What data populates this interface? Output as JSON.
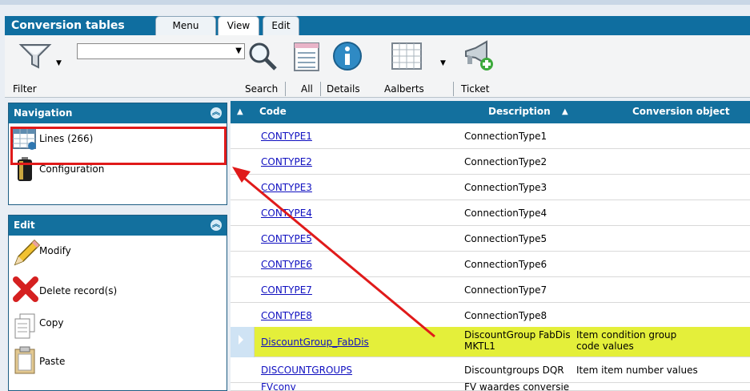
{
  "app": {
    "title": "Conversion tables",
    "tabs": [
      {
        "label": "Menu"
      },
      {
        "label": "View"
      },
      {
        "label": "Edit"
      }
    ]
  },
  "ribbon": {
    "filter_label": "Filter",
    "filter_value": "",
    "search_label": "Search",
    "all_label": "All",
    "details_label": "Details",
    "aalberts_label": "Aalberts",
    "ticket_label": "Ticket"
  },
  "navigation": {
    "title": "Navigation",
    "items": [
      {
        "label": "Lines (266)",
        "icon": "table-icon"
      },
      {
        "label": "Configuration",
        "icon": "battery-icon"
      }
    ]
  },
  "edit": {
    "title": "Edit",
    "items": [
      {
        "label": "Modify",
        "icon": "pencil-icon"
      },
      {
        "label": "Delete record(s)",
        "icon": "delete-x-icon"
      },
      {
        "label": "Copy",
        "icon": "copy-icon"
      },
      {
        "label": "Paste",
        "icon": "paste-icon"
      }
    ]
  },
  "grid": {
    "columns": [
      {
        "label": "Code"
      },
      {
        "label": "Description"
      },
      {
        "label": "Conversion object"
      }
    ],
    "rows": [
      {
        "code": "CONTYPE1",
        "desc": "ConnectionType1",
        "obj": ""
      },
      {
        "code": "CONTYPE2",
        "desc": "ConnectionType2",
        "obj": ""
      },
      {
        "code": "CONTYPE3",
        "desc": "ConnectionType3",
        "obj": ""
      },
      {
        "code": "CONTYPE4",
        "desc": "ConnectionType4",
        "obj": ""
      },
      {
        "code": "CONTYPE5",
        "desc": "ConnectionType5",
        "obj": ""
      },
      {
        "code": "CONTYPE6",
        "desc": "ConnectionType6",
        "obj": ""
      },
      {
        "code": "CONTYPE7",
        "desc": "ConnectionType7",
        "obj": ""
      },
      {
        "code": "CONTYPE8",
        "desc": "ConnectionType8",
        "obj": ""
      },
      {
        "code": "DiscountGroup_FabDis",
        "desc1": "DiscountGroup FabDis",
        "desc2": "MKTL1",
        "obj1": "Item condition group",
        "obj2": "code values",
        "selected": true
      },
      {
        "code": "DISCOUNTGROUPS",
        "desc": "Discountgroups DQR",
        "obj": "Item item number values"
      },
      {
        "code": "FVconv",
        "desc": "FV waardes conversie",
        "obj": ""
      }
    ]
  },
  "colors": {
    "header_blue": "#13709e",
    "highlight_yellow": "#e4ef3a",
    "annotation_red": "#e01a1a"
  }
}
